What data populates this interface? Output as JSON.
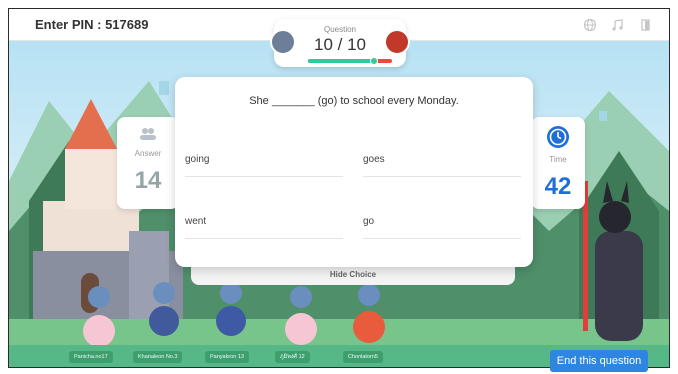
{
  "header": {
    "pin_text": "Enter PIN : 517689"
  },
  "toolbar_icons": [
    "globe-icon",
    "music-icon",
    "exit-icon"
  ],
  "question_header": {
    "label": "Question",
    "count": "10 / 10",
    "progress": 0.78
  },
  "answer_stat": {
    "label": "Answer",
    "value": "14"
  },
  "time_stat": {
    "label": "Time",
    "value": "42"
  },
  "question": {
    "text": "She _______ (go) to school every Monday.",
    "choices": [
      "going",
      "goes",
      "went",
      "go"
    ]
  },
  "hide_choice_label": "Hide Choice",
  "players": [
    "Panicha.no17",
    "Khanaleon No.3",
    "Panyakron 13",
    "ภูมิพงศ์ 12",
    "Chonlatorn5"
  ],
  "end_button_label": "End this question",
  "colors": {
    "accent": "#2f86e0",
    "time": "#1e6fd9",
    "answer": "#95a5a6",
    "ground": "#55b886"
  }
}
